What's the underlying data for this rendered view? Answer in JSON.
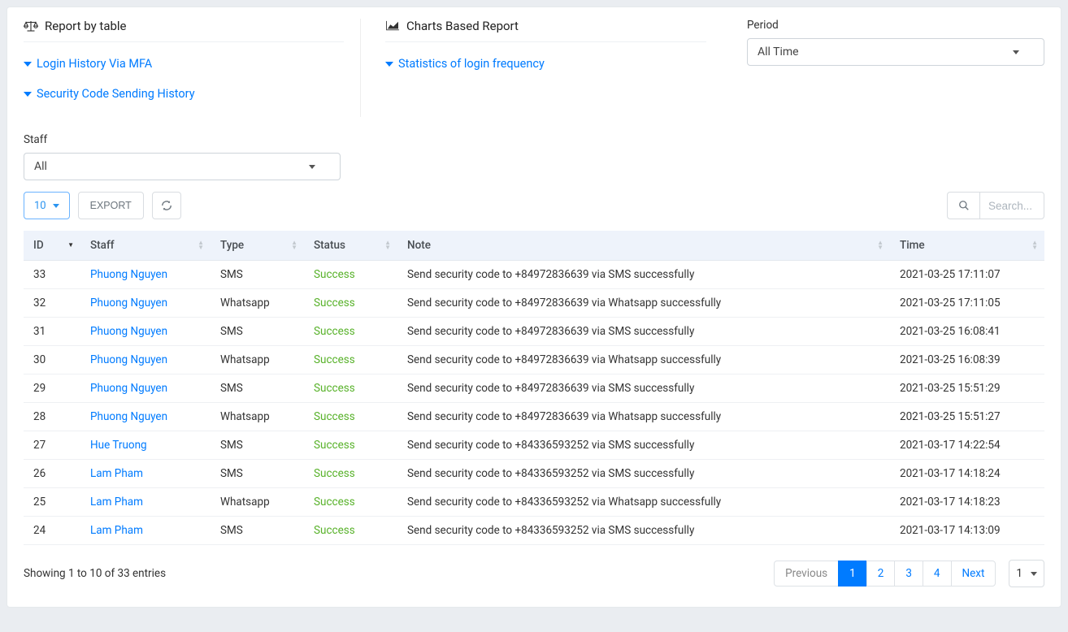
{
  "sections": {
    "tables": {
      "title": "Report by table",
      "items": [
        {
          "label": "Login History Via MFA"
        },
        {
          "label": "Security Code Sending History"
        }
      ]
    },
    "charts": {
      "title": "Charts Based Report",
      "items": [
        {
          "label": "Statistics of login frequency"
        }
      ]
    },
    "period": {
      "label": "Period",
      "value": "All Time"
    }
  },
  "filters": {
    "staff": {
      "label": "Staff",
      "value": "All"
    }
  },
  "toolbar": {
    "page_size": "10",
    "export_label": "EXPORT",
    "search_placeholder": "Search..."
  },
  "table": {
    "columns": [
      "ID",
      "Staff",
      "Type",
      "Status",
      "Note",
      "Time"
    ],
    "rows": [
      {
        "id": "33",
        "staff": "Phuong Nguyen",
        "type": "SMS",
        "status": "Success",
        "note": "Send security code to +84972836639 via SMS successfully",
        "time": "2021-03-25 17:11:07"
      },
      {
        "id": "32",
        "staff": "Phuong Nguyen",
        "type": "Whatsapp",
        "status": "Success",
        "note": "Send security code to +84972836639 via Whatsapp successfully",
        "time": "2021-03-25 17:11:05"
      },
      {
        "id": "31",
        "staff": "Phuong Nguyen",
        "type": "SMS",
        "status": "Success",
        "note": "Send security code to +84972836639 via SMS successfully",
        "time": "2021-03-25 16:08:41"
      },
      {
        "id": "30",
        "staff": "Phuong Nguyen",
        "type": "Whatsapp",
        "status": "Success",
        "note": "Send security code to +84972836639 via Whatsapp successfully",
        "time": "2021-03-25 16:08:39"
      },
      {
        "id": "29",
        "staff": "Phuong Nguyen",
        "type": "SMS",
        "status": "Success",
        "note": "Send security code to +84972836639 via SMS successfully",
        "time": "2021-03-25 15:51:29"
      },
      {
        "id": "28",
        "staff": "Phuong Nguyen",
        "type": "Whatsapp",
        "status": "Success",
        "note": "Send security code to +84972836639 via Whatsapp successfully",
        "time": "2021-03-25 15:51:27"
      },
      {
        "id": "27",
        "staff": "Hue Truong",
        "type": "SMS",
        "status": "Success",
        "note": "Send security code to +84336593252 via SMS successfully",
        "time": "2021-03-17 14:22:54"
      },
      {
        "id": "26",
        "staff": "Lam Pham",
        "type": "SMS",
        "status": "Success",
        "note": "Send security code to +84336593252 via SMS successfully",
        "time": "2021-03-17 14:18:24"
      },
      {
        "id": "25",
        "staff": "Lam Pham",
        "type": "Whatsapp",
        "status": "Success",
        "note": "Send security code to +84336593252 via Whatsapp successfully",
        "time": "2021-03-17 14:18:23"
      },
      {
        "id": "24",
        "staff": "Lam Pham",
        "type": "SMS",
        "status": "Success",
        "note": "Send security code to +84336593252 via SMS successfully",
        "time": "2021-03-17 14:13:09"
      }
    ]
  },
  "footer": {
    "entries_info": "Showing 1 to 10 of 33 entries",
    "prev_label": "Previous",
    "next_label": "Next",
    "pages": [
      "1",
      "2",
      "3",
      "4"
    ],
    "current_page": "1",
    "jump_value": "1"
  }
}
